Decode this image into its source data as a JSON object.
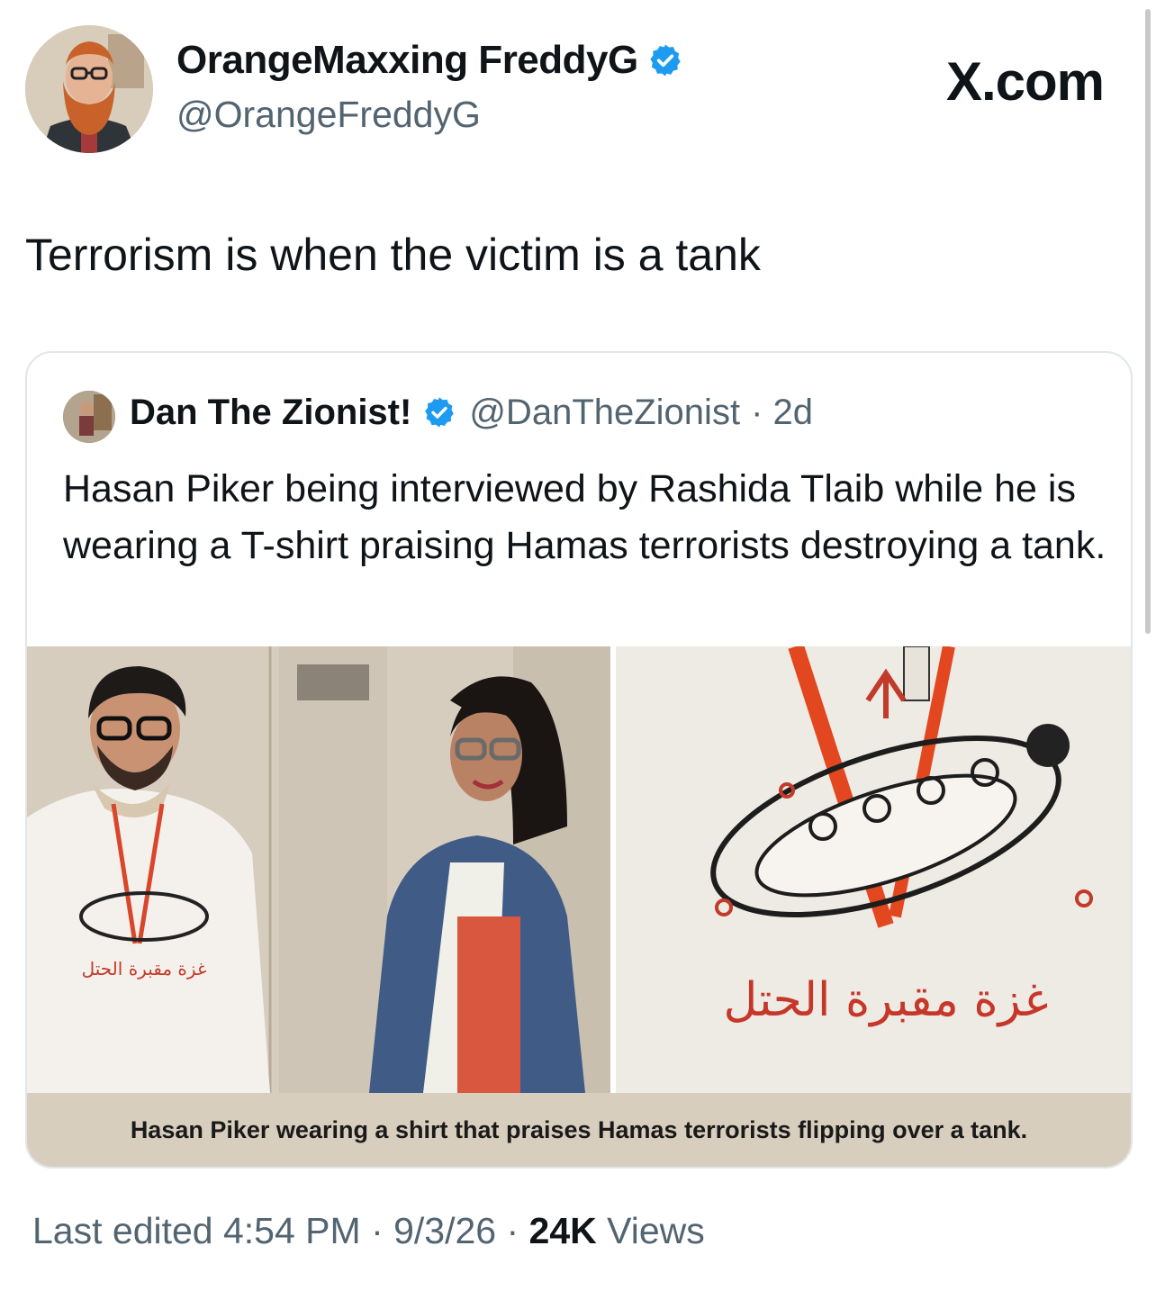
{
  "tweet": {
    "author_name": "OrangeMaxxing FreddyG",
    "author_handle": "@OrangeFreddyG",
    "brand": "X.com",
    "text": "Terrorism is when the victim is a tank",
    "verified_icon": "verified-badge-icon",
    "accent_color": "#1d9bf0"
  },
  "quote": {
    "author_name": "Dan The Zionist!",
    "author_handle": "@DanTheZionist",
    "time": "· 2d",
    "text": "Hasan Piker being interviewed by Rashida Tlaib while he is wearing a T-shirt praising Hamas terrorists destroying a tank.",
    "caption": "Hasan Piker wearing a shirt that praises Hamas terrorists flipping over a tank.",
    "shirt_text": "غزة مقبرة الحتل"
  },
  "footer": {
    "edited": "Last edited 4:54 PM · 9/3/26",
    "separator": " · ",
    "views_count": "24K",
    "views_label": " Views"
  }
}
